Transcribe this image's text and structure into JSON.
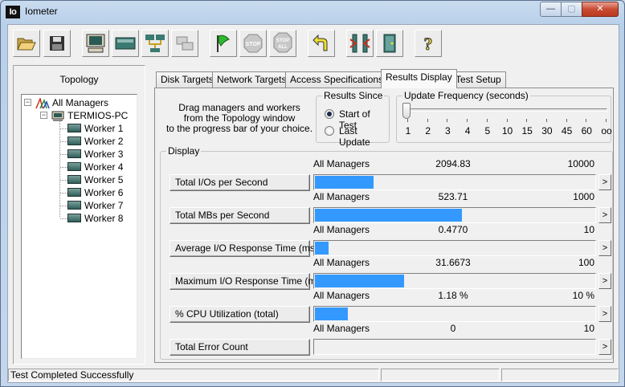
{
  "window": {
    "title": "Iometer",
    "icon_label": "Io"
  },
  "window_controls": {
    "minimize": "—",
    "maximize": "▢",
    "close": "✕"
  },
  "toolbar": {
    "buttons": [
      {
        "name": "open-config",
        "icon": "folder-open-icon"
      },
      {
        "name": "save-config",
        "icon": "floppy-disk-icon"
      },
      {
        "name": "show-results",
        "icon": "computer-monitor-icon"
      },
      {
        "name": "new-disk-worker",
        "icon": "disk-drive-icon"
      },
      {
        "name": "new-network-worker",
        "icon": "network-icon"
      },
      {
        "name": "duplicate-worker",
        "icon": "duplicate-icon"
      },
      {
        "name": "start-tests",
        "icon": "green-flag-icon"
      },
      {
        "name": "stop-test",
        "icon": "stop-sign-icon",
        "label": "STOP"
      },
      {
        "name": "stop-all",
        "icon": "stop-all-icon",
        "label": "STOP ALL"
      },
      {
        "name": "reset-workers",
        "icon": "reset-arrow-icon"
      },
      {
        "name": "exit-managers",
        "icon": "disconnect-icon"
      },
      {
        "name": "quit",
        "icon": "exit-door-icon"
      },
      {
        "name": "help",
        "icon": "help-question-icon",
        "label": "?"
      }
    ]
  },
  "topology": {
    "title": "Topology",
    "root": "All Managers",
    "manager": "TERMIOS-PC",
    "workers": [
      "Worker 1",
      "Worker 2",
      "Worker 3",
      "Worker 4",
      "Worker 5",
      "Worker 6",
      "Worker 7",
      "Worker 8"
    ]
  },
  "tabs": [
    {
      "label": "Disk Targets",
      "active": false
    },
    {
      "label": "Network Targets",
      "active": false
    },
    {
      "label": "Access Specifications",
      "active": false
    },
    {
      "label": "Results Display",
      "active": true
    },
    {
      "label": "Test Setup",
      "active": false
    }
  ],
  "results": {
    "drag_text_lines": [
      "Drag managers and workers",
      "from the Topology window",
      "to the progress bar of your choice."
    ],
    "results_since": {
      "label": "Results Since",
      "options": [
        {
          "label": "Start of Test",
          "checked": true
        },
        {
          "label": "Last Update",
          "checked": false
        }
      ]
    },
    "update_frequency": {
      "label": "Update Frequency (seconds)",
      "ticks": [
        "1",
        "2",
        "3",
        "4",
        "5",
        "10",
        "15",
        "30",
        "45",
        "60",
        "oo"
      ],
      "selected": "1"
    },
    "display_label": "Display",
    "metrics": [
      {
        "label": "Total I/Os per Second",
        "source": "All Managers",
        "value": "2094.83",
        "max": "10000",
        "fraction": 0.2095
      },
      {
        "label": "Total MBs per Second",
        "source": "All Managers",
        "value": "523.71",
        "max": "1000",
        "fraction": 0.5237
      },
      {
        "label": "Average I/O Response Time (ms)",
        "source": "All Managers",
        "value": "0.4770",
        "max": "10",
        "fraction": 0.0477
      },
      {
        "label": "Maximum I/O Response Time (ms)",
        "source": "All Managers",
        "value": "31.6673",
        "max": "100",
        "fraction": 0.3167
      },
      {
        "label": "% CPU Utilization (total)",
        "source": "All Managers",
        "value": "1.18 %",
        "max": "10 %",
        "fraction": 0.118
      },
      {
        "label": "Total Error Count",
        "source": "All Managers",
        "value": "0",
        "max": "10",
        "fraction": 0
      }
    ],
    "more_label": ">"
  },
  "status": {
    "text": "Test Completed Successfully"
  },
  "colors": {
    "bar_fill": "#3399ff"
  }
}
